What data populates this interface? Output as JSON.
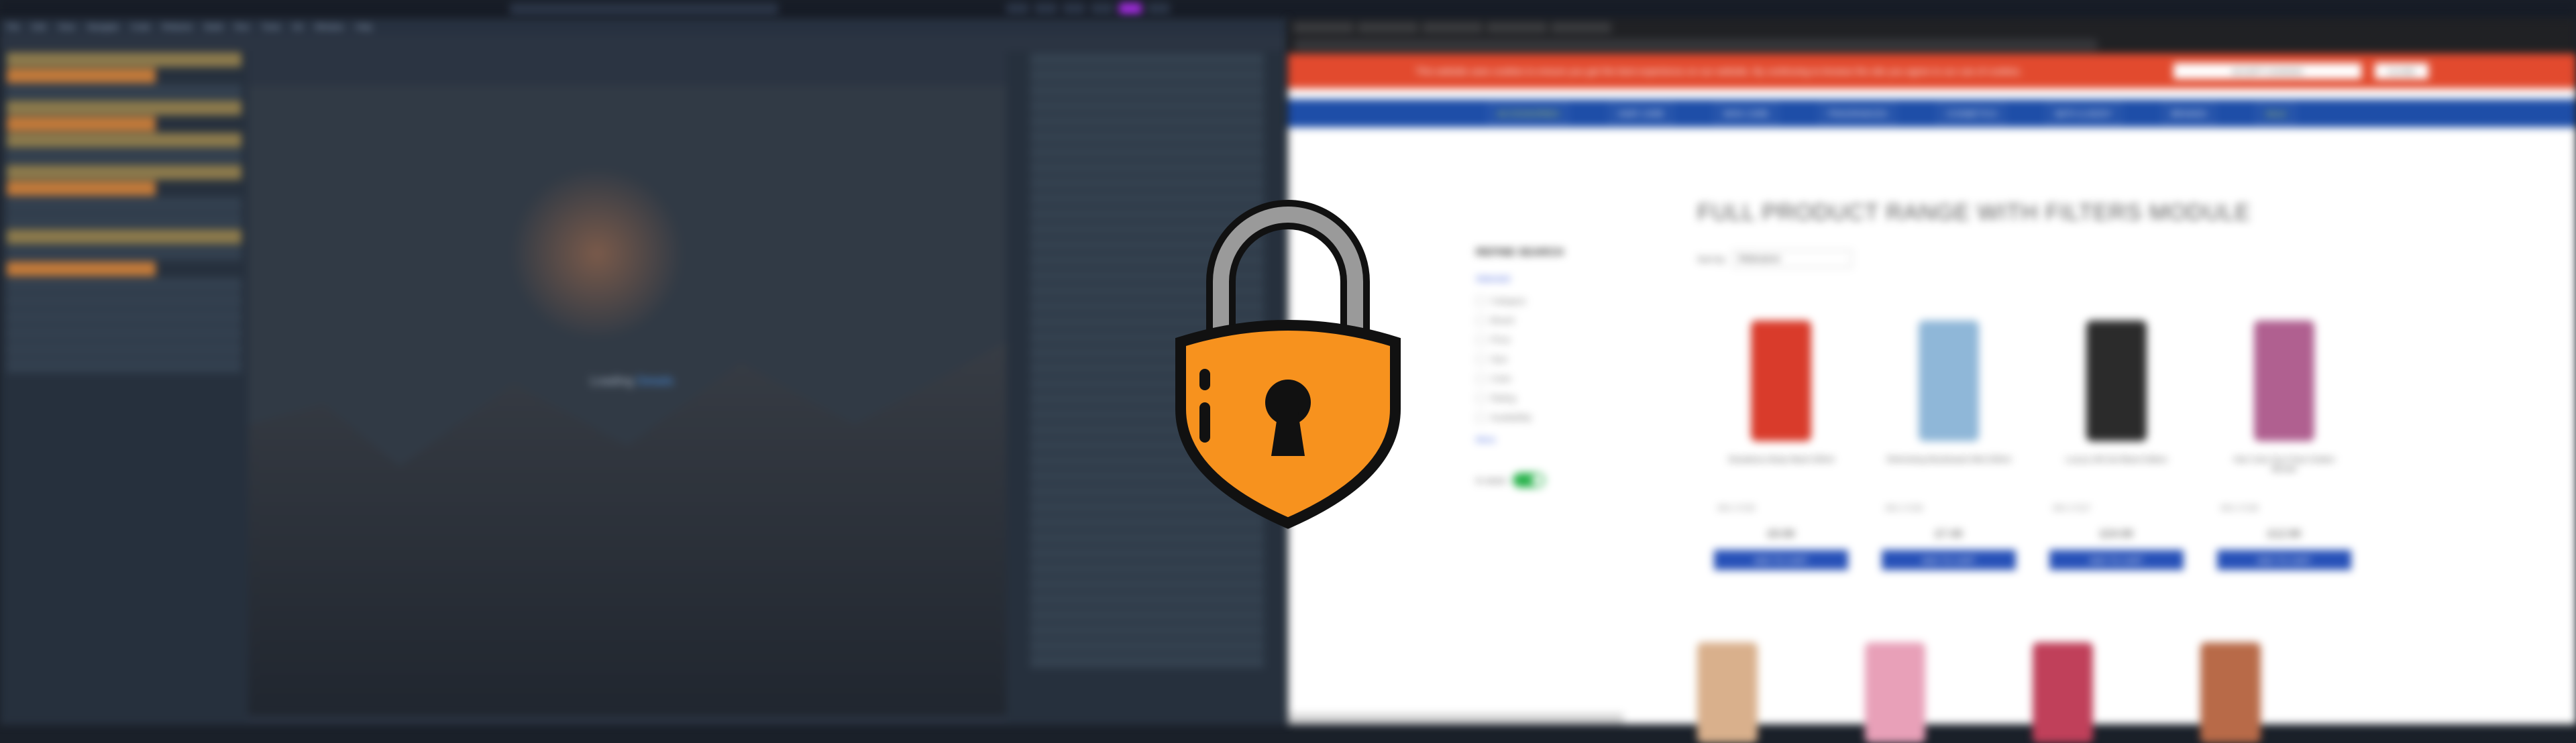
{
  "topbar": {
    "center_title": "",
    "tray_count": 6
  },
  "ide": {
    "menu": [
      "File",
      "Edit",
      "View",
      "Navigate",
      "Code",
      "Refactor",
      "Build",
      "Run",
      "Tools",
      "Git",
      "Window",
      "Help"
    ],
    "editor_caption_prefix": "Loading",
    "editor_caption_link": "Details"
  },
  "browser": {
    "cookie_message": "This website uses cookies to ensure you get the best experience on our website. By continuing to browse the site you agree to our use of cookies.",
    "cookie_accept": "ACCEPT COOKIES",
    "cookie_close": "CLOSE",
    "nav": [
      {
        "label": "ACCESSORIES",
        "green": true
      },
      {
        "label": "HAIR CARE",
        "green": false
      },
      {
        "label": "SKIN CARE",
        "green": false
      },
      {
        "label": "FRAGRANCES",
        "green": false
      },
      {
        "label": "COSMETICS",
        "green": false
      },
      {
        "label": "BATH & BODY",
        "green": false
      },
      {
        "label": "BRANDS",
        "green": false
      },
      {
        "label": "SALE",
        "green": true
      }
    ],
    "page_title": "FULL PRODUCT RANGE WITH FILTERS MODULE",
    "sidebar": {
      "heading": "REFINE SEARCH",
      "selected": "Selected",
      "filters": [
        "Category",
        "Brand",
        "Price",
        "Size",
        "Color",
        "Rating",
        "Availability"
      ],
      "more": "More",
      "toggle_label": "In stock"
    },
    "sort": {
      "label": "Sort by",
      "value": "Relevance"
    },
    "products": [
      {
        "name": "Strawberry Body Wash 500ml",
        "sku": "SKU 17125",
        "price": "£9.99",
        "cart": "ADD TO CART",
        "color": "#d93b2b"
      },
      {
        "name": "Refreshing Mouthwash Mint 500ml",
        "sku": "SKU 17126",
        "price": "£7.49",
        "cart": "ADD TO CART",
        "color": "#8fb7d8"
      },
      {
        "name": "Luxury Gift Set Black Edition",
        "sku": "SKU 17127",
        "price": "£24.99",
        "cart": "ADD TO CART",
        "color": "#2b2b2b"
      },
      {
        "name": "Hair Color Duo Pack Golden Blonde",
        "sku": "SKU 17128",
        "price": "£12.99",
        "cart": "ADD TO CART",
        "color": "#b06090"
      }
    ],
    "row2_colors": [
      "#d9b08c",
      "#e8a0b8",
      "#c0405a",
      "#b86a48"
    ]
  },
  "lock": {
    "fill": "#f7921e",
    "outline": "#111111",
    "shackle": "#9a9a9a"
  }
}
